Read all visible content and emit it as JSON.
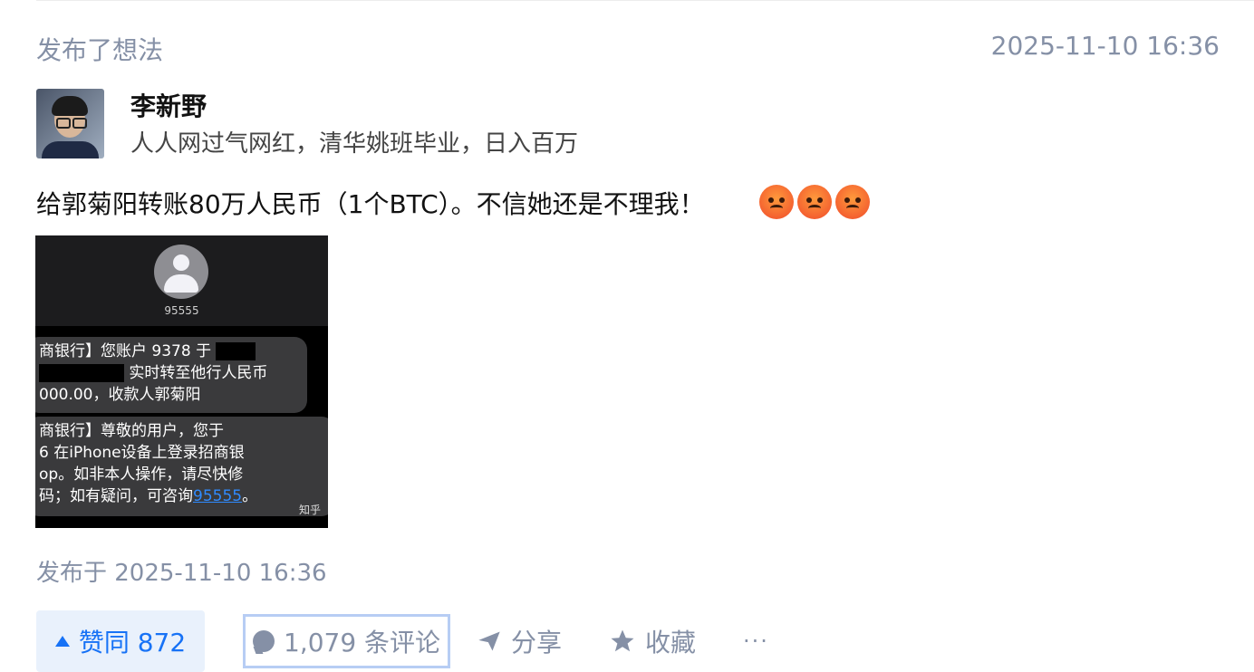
{
  "header": {
    "activity": "发布了想法",
    "timestamp": "2025-11-10 16:36"
  },
  "author": {
    "name": "李新野",
    "bio": "人人网过气网红，清华姚班毕业，日入百万"
  },
  "post": {
    "text": "给郭菊阳转账80万人民币（1个BTC）。不信她还是不理我！",
    "emojis": [
      "angry-crying-face-emoji",
      "angry-crying-face-emoji",
      "angry-crying-face-emoji"
    ],
    "image": {
      "sender": "95555",
      "msg1": {
        "l1a": "商银行】您账户 9378 于",
        "l2b": "实时转至他行人民币",
        "l3": "000.00，收款人郭菊阳"
      },
      "msg2": {
        "l1": "商银行】尊敬的用户，您于",
        "l2": "6 在iPhone设备上登录招商银",
        "l3": "op。如非本人操作，请尽快修",
        "l4a": "码；如有疑问，可咨询",
        "link": "95555",
        "l4b": "。"
      },
      "watermark": "知乎"
    },
    "published": "发布于 2025-11-10 16:36"
  },
  "actions": {
    "vote": "赞同 872",
    "comments": "1,079 条评论",
    "share": "分享",
    "favorite": "收藏",
    "more": "···"
  },
  "colors": {
    "accent": "#1772f6",
    "meta": "#8590a6",
    "vote_bg": "#e9f1fc"
  }
}
